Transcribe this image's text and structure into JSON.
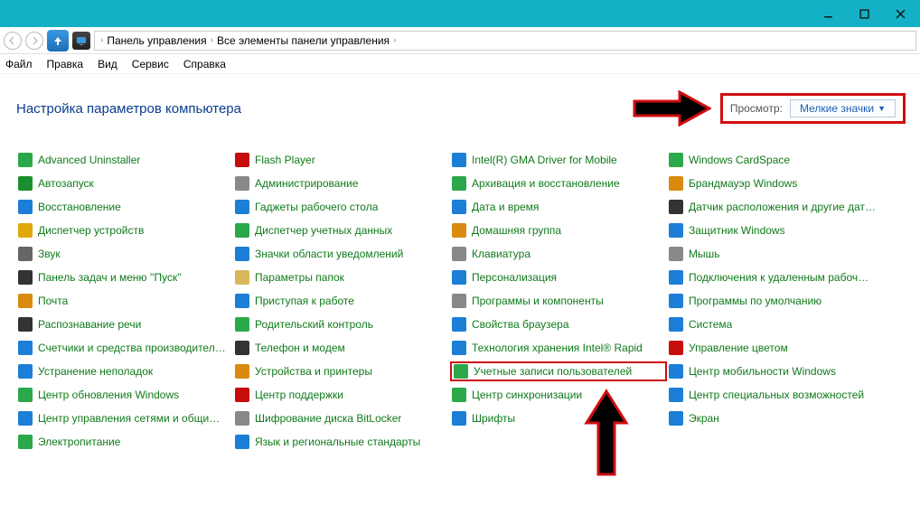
{
  "window_controls": {
    "min": "min",
    "max": "max",
    "close": "close"
  },
  "breadcrumb": {
    "p1": "Панель управления",
    "p2": "Все элементы панели управления"
  },
  "menubar": {
    "file": "Файл",
    "edit": "Правка",
    "view": "Вид",
    "service": "Сервис",
    "help": "Справка"
  },
  "page_title": "Настройка параметров компьютера",
  "view": {
    "label": "Просмотр:",
    "value": "Мелкие значки"
  },
  "items": {
    "c0": [
      {
        "t": "Advanced Uninstaller",
        "c": "#2aa84a"
      },
      {
        "t": "Автозапуск",
        "c": "#1b8f2d"
      },
      {
        "t": "Восстановление",
        "c": "#1c7ed6"
      },
      {
        "t": "Диспетчер устройств",
        "c": "#e2a70a"
      },
      {
        "t": "Звук",
        "c": "#666"
      },
      {
        "t": "Панель задач и меню ''Пуск''",
        "c": "#333"
      },
      {
        "t": "Почта",
        "c": "#d88b0f"
      },
      {
        "t": "Распознавание речи",
        "c": "#333"
      },
      {
        "t": "Счетчики и средства производител…",
        "c": "#1c7ed6"
      },
      {
        "t": "Устранение неполадок",
        "c": "#1c7ed6"
      },
      {
        "t": "Центр обновления Windows",
        "c": "#2aa84a"
      },
      {
        "t": "Центр управления сетями и общи…",
        "c": "#1c7ed6"
      },
      {
        "t": "Электропитание",
        "c": "#2aa84a"
      }
    ],
    "c1": [
      {
        "t": "Flash Player",
        "c": "#c70c0c"
      },
      {
        "t": "Администрирование",
        "c": "#888"
      },
      {
        "t": "Гаджеты рабочего стола",
        "c": "#1c7ed6"
      },
      {
        "t": "Диспетчер учетных данных",
        "c": "#2aa84a"
      },
      {
        "t": "Значки области уведомлений",
        "c": "#1c7ed6"
      },
      {
        "t": "Параметры папок",
        "c": "#d8b85a"
      },
      {
        "t": "Приступая к работе",
        "c": "#1c7ed6"
      },
      {
        "t": "Родительский контроль",
        "c": "#2aa84a"
      },
      {
        "t": "Телефон и модем",
        "c": "#333"
      },
      {
        "t": "Устройства и принтеры",
        "c": "#d88b0f"
      },
      {
        "t": "Центр поддержки",
        "c": "#c70c0c"
      },
      {
        "t": "Шифрование диска BitLocker",
        "c": "#888"
      },
      {
        "t": "Язык и региональные стандарты",
        "c": "#1c7ed6"
      }
    ],
    "c2": [
      {
        "t": "Intel(R) GMA Driver for Mobile",
        "c": "#1c7ed6"
      },
      {
        "t": "Архивация и восстановление",
        "c": "#2aa84a"
      },
      {
        "t": "Дата и время",
        "c": "#1c7ed6"
      },
      {
        "t": "Домашняя группа",
        "c": "#d88b0f"
      },
      {
        "t": "Клавиатура",
        "c": "#888"
      },
      {
        "t": "Персонализация",
        "c": "#1c7ed6"
      },
      {
        "t": "Программы и компоненты",
        "c": "#888"
      },
      {
        "t": "Свойства браузера",
        "c": "#1c7ed6"
      },
      {
        "t": "Технология хранения Intel® Rapid",
        "c": "#1c7ed6"
      },
      {
        "t": "Учетные записи пользователей",
        "c": "#2aa84a",
        "hl": true
      },
      {
        "t": "Центр синхронизации",
        "c": "#2aa84a"
      },
      {
        "t": "Шрифты",
        "c": "#1c7ed6"
      }
    ],
    "c3": [
      {
        "t": "Windows CardSpace",
        "c": "#2aa84a"
      },
      {
        "t": "Брандмауэр Windows",
        "c": "#d88b0f"
      },
      {
        "t": "Датчик расположения и другие дат…",
        "c": "#333"
      },
      {
        "t": "Защитник Windows",
        "c": "#1c7ed6"
      },
      {
        "t": "Мышь",
        "c": "#888"
      },
      {
        "t": "Подключения к удаленным рабоч…",
        "c": "#1c7ed6"
      },
      {
        "t": "Программы по умолчанию",
        "c": "#1c7ed6"
      },
      {
        "t": "Система",
        "c": "#1c7ed6"
      },
      {
        "t": "Управление цветом",
        "c": "#c70c0c"
      },
      {
        "t": "Центр мобильности Windows",
        "c": "#1c7ed6"
      },
      {
        "t": "Центр специальных возможностей",
        "c": "#1c7ed6"
      },
      {
        "t": "Экран",
        "c": "#1c7ed6"
      }
    ]
  }
}
